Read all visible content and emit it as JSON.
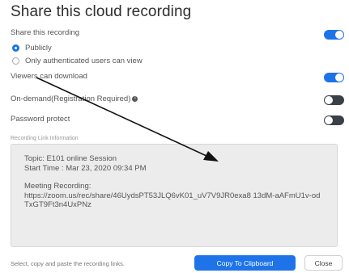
{
  "dialog": {
    "title": "Share this cloud recording",
    "share_label": "Share this recording",
    "radio_options": [
      {
        "label": "Publicly",
        "selected": true
      },
      {
        "label": "Only authenticated users can view",
        "selected": false
      }
    ],
    "toggles": [
      {
        "label": "Viewers can download",
        "on": true
      },
      {
        "label": "On-demand(Registration Required)",
        "on": false,
        "info_icon": "info-icon"
      },
      {
        "label": "Password protect",
        "on": false
      }
    ],
    "link_info_label": "Recording Link Information",
    "topic": "Topic: E101 online Session",
    "start_time": "Start Time : Mar 23, 2020 09:34 PM",
    "meeting_label": "Meeting Recording:",
    "recording_url": "https://zoom.us/rec/share/46UydsPT53JLQ6vK01_uV7V9JR0exa8 13dM-aAFmU1v-odTxGT9Ft3n4UxPNz",
    "footer_hint": "Select, copy and paste the recording links.",
    "copy_button": "Copy To Clipboard",
    "close_button": "Close"
  },
  "colors": {
    "accent": "#1e73e8",
    "toggle_off": "#3b4048",
    "annotation_arrow": "#111111"
  }
}
